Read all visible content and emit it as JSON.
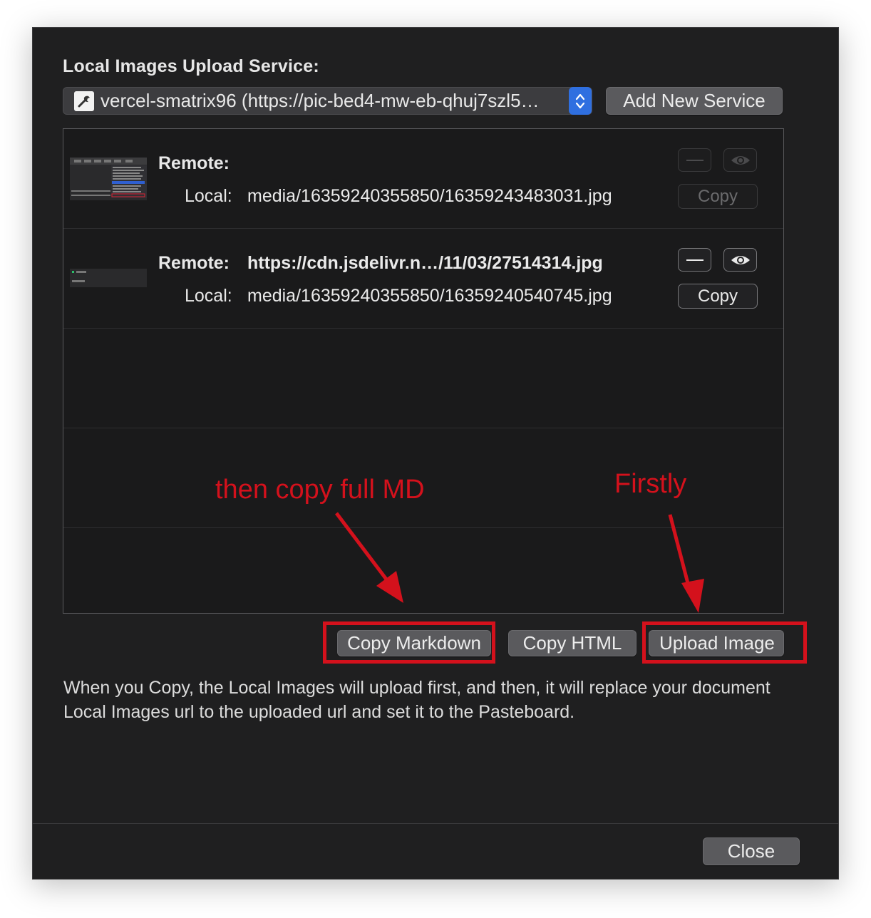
{
  "dialog": {
    "section_label": "Local Images Upload Service:",
    "service_select": {
      "value": "vercel-smatrix96 (https://pic-bed4-mw-eb-qhuj7szl5…",
      "icon": "wrench-icon"
    },
    "add_service_label": "Add New Service"
  },
  "images": [
    {
      "remote_label": "Remote:",
      "remote_value": "",
      "local_label": "Local:",
      "local_value": "media/16359240355850/16359243483031.jpg",
      "copy_label": "Copy",
      "uploaded": false
    },
    {
      "remote_label": "Remote:",
      "remote_value": "https://cdn.jsdelivr.n…/11/03/27514314.jpg",
      "local_label": "Local:",
      "local_value": "media/16359240355850/16359240540745.jpg",
      "copy_label": "Copy",
      "uploaded": true
    }
  ],
  "actions": {
    "copy_markdown": "Copy Markdown",
    "copy_html": "Copy HTML",
    "upload_image": "Upload Image"
  },
  "note": "When you Copy, the Local Images will upload first, and then, it will replace your document Local Images url to the uploaded url and set it to the Pasteboard.",
  "footer": {
    "close_label": "Close"
  },
  "annotations": {
    "step2": "then copy full MD",
    "step1": "Firstly",
    "color": "#d4111c"
  },
  "colors": {
    "background": "#1f1f20",
    "accent": "#2f6fe0"
  }
}
